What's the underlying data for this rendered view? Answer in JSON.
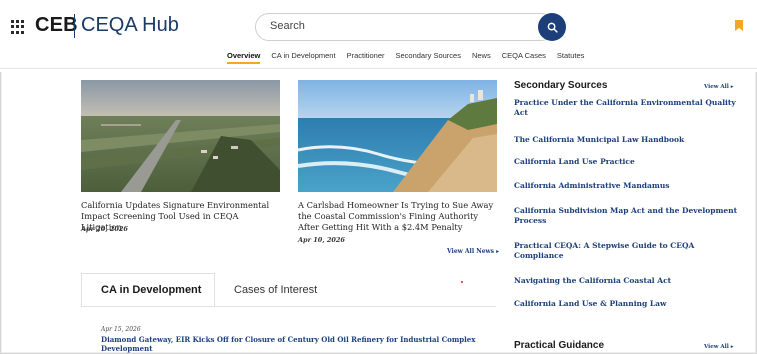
{
  "header": {
    "brand": "CEB",
    "product": "CEQA Hub",
    "search_placeholder": "Search"
  },
  "nav": [
    {
      "label": "Overview",
      "active": true
    },
    {
      "label": "CA in Development",
      "active": false
    },
    {
      "label": "Practitioner",
      "active": false
    },
    {
      "label": "Secondary Sources",
      "active": false
    },
    {
      "label": "News",
      "active": false
    },
    {
      "label": "CEQA Cases",
      "active": false
    },
    {
      "label": "Statutes",
      "active": false
    }
  ],
  "news": {
    "cards": [
      {
        "title": "California Updates Signature Environmental Impact Screening Tool Used in CEQA Litigation",
        "date": "Apr 20, 2026"
      },
      {
        "title": "A Carlsbad Homeowner Is Trying to Sue Away the Coastal Commission's Fining Authority After Getting Hit With a $2.4M Penalty",
        "date": "Apr 10, 2026"
      }
    ],
    "view_all": "View All News ▸"
  },
  "tabs": {
    "active": "CA in Development",
    "other": "Cases of Interest"
  },
  "development": {
    "date": "Apr 15, 2026",
    "title": "Diamond Gateway, EIR Kicks Off for Closure of Century Old Oil Refinery for Industrial Complex Development"
  },
  "sidebar": {
    "secondary_sources": {
      "heading": "Secondary Sources",
      "view_all": "View All ▸",
      "items": [
        "Practice Under the California Environmental Quality Act",
        "The California Municipal Law Handbook",
        "California Land Use Practice",
        "California Administrative Mandamus",
        "California Subdivision Map Act and the Development Process",
        "Practical CEQA: A Stepwise Guide to CEQA Compliance",
        "Navigating the California Coastal Act",
        "California Land Use & Planning Law"
      ]
    },
    "practical_guidance": {
      "heading": "Practical Guidance",
      "view_all": "View All ▸"
    }
  },
  "colors": {
    "accent": "#f5a623",
    "link": "#1c3f7a",
    "search_button": "#1c3f7a"
  }
}
